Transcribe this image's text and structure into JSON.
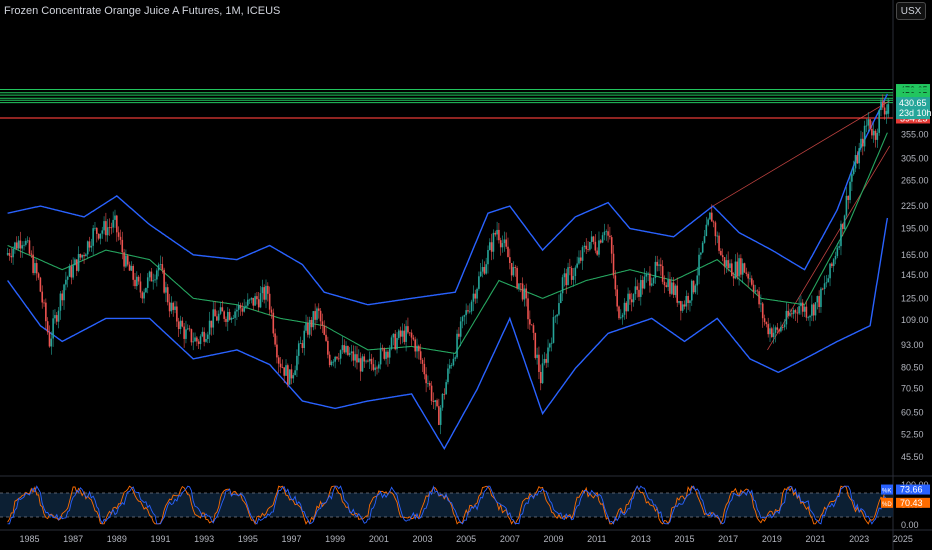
{
  "header": {
    "title": "Frozen Concentrate Orange Juice A Futures, 1M, ICEUS",
    "currency": "USX"
  },
  "colors": {
    "background": "#000000",
    "bull": "#26a69a",
    "bear": "#ef5350",
    "band": "#2962ff",
    "basis": "#26a660",
    "resistance": "#22c55e",
    "support": "#e53935",
    "trend": "#ef5350",
    "stoch_k": "#2962ff",
    "stoch_d": "#ff6d00",
    "axis_text": "#b2b5be"
  },
  "chart_data": [
    {
      "type": "candlestick",
      "title": "Frozen Concentrate Orange Juice A Futures, 1M, ICEUS",
      "scale": "log",
      "y_ticks": [
        45.5,
        52.5,
        60.5,
        70.5,
        80.5,
        93.0,
        109.0,
        125.0,
        145.0,
        165.0,
        195.0,
        225.0,
        265.0,
        305.0,
        355.0
      ],
      "x_ticks": [
        "1985",
        "1987",
        "1989",
        "1991",
        "1993",
        "1995",
        "1997",
        "1999",
        "2001",
        "2003",
        "2005",
        "2007",
        "2009",
        "2011",
        "2013",
        "2015",
        "2017",
        "2019",
        "2021",
        "2023",
        "2025"
      ],
      "price_path": [
        [
          1984.5,
          165
        ],
        [
          1985.3,
          185
        ],
        [
          1986.0,
          140
        ],
        [
          1986.5,
          95
        ],
        [
          1987.2,
          140
        ],
        [
          1988.0,
          165
        ],
        [
          1988.5,
          190
        ],
        [
          1989.5,
          200
        ],
        [
          1990.0,
          155
        ],
        [
          1990.7,
          130
        ],
        [
          1991.5,
          155
        ],
        [
          1992.0,
          120
        ],
        [
          1992.7,
          100
        ],
        [
          1993.3,
          95
        ],
        [
          1994.0,
          110
        ],
        [
          1994.8,
          115
        ],
        [
          1995.6,
          120
        ],
        [
          1996.5,
          130
        ],
        [
          1997.0,
          85
        ],
        [
          1997.5,
          75
        ],
        [
          1998.2,
          100
        ],
        [
          1998.8,
          115
        ],
        [
          1999.3,
          85
        ],
        [
          1999.8,
          90
        ],
        [
          2000.5,
          85
        ],
        [
          2001.0,
          80
        ],
        [
          2001.5,
          85
        ],
        [
          2002.3,
          95
        ],
        [
          2002.8,
          100
        ],
        [
          2003.2,
          95
        ],
        [
          2003.8,
          75
        ],
        [
          2004.3,
          58
        ],
        [
          2004.8,
          80
        ],
        [
          2005.5,
          110
        ],
        [
          2006.5,
          160
        ],
        [
          2007.0,
          195
        ],
        [
          2007.3,
          175
        ],
        [
          2007.8,
          145
        ],
        [
          2008.2,
          130
        ],
        [
          2008.6,
          100
        ],
        [
          2009.0,
          75
        ],
        [
          2009.5,
          100
        ],
        [
          2010.0,
          140
        ],
        [
          2010.6,
          150
        ],
        [
          2011.2,
          180
        ],
        [
          2011.6,
          175
        ],
        [
          2011.9,
          200
        ],
        [
          2012.2,
          175
        ],
        [
          2012.5,
          115
        ],
        [
          2012.9,
          120
        ],
        [
          2013.3,
          130
        ],
        [
          2013.8,
          140
        ],
        [
          2014.3,
          150
        ],
        [
          2014.8,
          140
        ],
        [
          2015.5,
          120
        ],
        [
          2016.0,
          135
        ],
        [
          2016.5,
          180
        ],
        [
          2016.8,
          215
        ],
        [
          2017.3,
          160
        ],
        [
          2017.8,
          150
        ],
        [
          2018.2,
          155
        ],
        [
          2018.7,
          140
        ],
        [
          2019.3,
          105
        ],
        [
          2019.8,
          100
        ],
        [
          2020.3,
          110
        ],
        [
          2020.8,
          120
        ],
        [
          2021.3,
          115
        ],
        [
          2021.8,
          125
        ],
        [
          2022.3,
          150
        ],
        [
          2022.8,
          200
        ],
        [
          2023.2,
          270
        ],
        [
          2023.6,
          320
        ],
        [
          2024.0,
          390
        ],
        [
          2024.3,
          350
        ],
        [
          2024.6,
          430
        ],
        [
          2024.8,
          420
        ]
      ],
      "last_candle": {
        "open": 405,
        "high": 448,
        "low": 395,
        "close": 430.65
      }
    },
    {
      "type": "line",
      "name": "Bollinger Bands",
      "basis": [
        [
          1984.5,
          175
        ],
        [
          1987,
          150
        ],
        [
          1989,
          170
        ],
        [
          1991,
          160
        ],
        [
          1993,
          125
        ],
        [
          1995,
          120
        ],
        [
          1997,
          110
        ],
        [
          1999,
          105
        ],
        [
          2001,
          90
        ],
        [
          2003,
          92
        ],
        [
          2005,
          88
        ],
        [
          2007,
          140
        ],
        [
          2009,
          125
        ],
        [
          2011,
          140
        ],
        [
          2013,
          150
        ],
        [
          2015,
          140
        ],
        [
          2017,
          160
        ],
        [
          2019,
          125
        ],
        [
          2021,
          120
        ],
        [
          2023,
          200
        ],
        [
          2024.8,
          360
        ]
      ],
      "upper": [
        [
          1984.5,
          215
        ],
        [
          1986,
          225
        ],
        [
          1988,
          210
        ],
        [
          1989.5,
          240
        ],
        [
          1991,
          200
        ],
        [
          1993,
          165
        ],
        [
          1995,
          160
        ],
        [
          1996.5,
          175
        ],
        [
          1998,
          155
        ],
        [
          1999,
          130
        ],
        [
          2001,
          120
        ],
        [
          2003,
          125
        ],
        [
          2005,
          130
        ],
        [
          2006.5,
          215
        ],
        [
          2007.5,
          225
        ],
        [
          2009,
          170
        ],
        [
          2010.5,
          210
        ],
        [
          2012,
          230
        ],
        [
          2013,
          195
        ],
        [
          2015,
          185
        ],
        [
          2016.8,
          225
        ],
        [
          2018,
          190
        ],
        [
          2019.5,
          170
        ],
        [
          2021,
          150
        ],
        [
          2022.5,
          220
        ],
        [
          2023.5,
          320
        ],
        [
          2024.8,
          460
        ]
      ],
      "lower": [
        [
          1984.5,
          140
        ],
        [
          1986,
          105
        ],
        [
          1987,
          95
        ],
        [
          1989,
          110
        ],
        [
          1991,
          110
        ],
        [
          1993,
          85
        ],
        [
          1995,
          90
        ],
        [
          1996.5,
          82
        ],
        [
          1998,
          65
        ],
        [
          1999.5,
          62
        ],
        [
          2001,
          65
        ],
        [
          2003,
          68
        ],
        [
          2004.5,
          48
        ],
        [
          2006,
          70
        ],
        [
          2007.5,
          110
        ],
        [
          2009,
          60
        ],
        [
          2010.5,
          80
        ],
        [
          2012,
          100
        ],
        [
          2014,
          110
        ],
        [
          2015.5,
          95
        ],
        [
          2017,
          110
        ],
        [
          2018.5,
          85
        ],
        [
          2019.8,
          78
        ],
        [
          2021,
          85
        ],
        [
          2022.5,
          95
        ],
        [
          2024,
          105
        ],
        [
          2024.8,
          210
        ]
      ]
    },
    {
      "type": "lines",
      "name": "levels",
      "resistance": [
        472.65,
        463.05,
        456.15,
        447.2,
        441.55,
        434.85
      ],
      "support": [
        394.25
      ],
      "price_label": "430.65",
      "countdown_label": "23d 10h"
    },
    {
      "type": "line",
      "name": "Stochastic",
      "y_ticks": [
        100.0,
        50.0,
        0.0
      ],
      "ylim": [
        0,
        100
      ],
      "k_label": "73.66",
      "d_label": "70.43",
      "k_value": 73.66,
      "d_value": 70.43
    }
  ]
}
